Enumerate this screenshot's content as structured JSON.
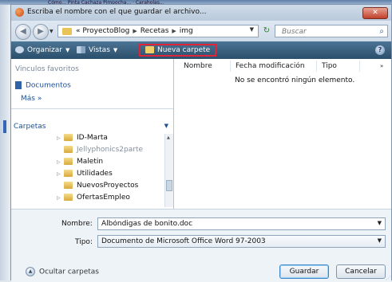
{
  "background": {
    "tabs_text": "Cómo... Pinta Cachaza Pimpocha... · Caraholas..."
  },
  "dialog": {
    "title": "Escriba el nombre con el que guardar el archivo...",
    "close_label": "✕",
    "address": {
      "crumbs": [
        "« ProyectoBlog",
        "Recetas",
        "img"
      ],
      "search_placeholder": "Buscar"
    },
    "toolbar": {
      "organizar": "Organizar",
      "vistas": "Vistas",
      "nueva_carpeta": "Nueva carpete",
      "highlight_color": "#e0243a"
    },
    "left_pane": {
      "favoritos_heading": "Vinculos favoritos",
      "documentos": "Documentos",
      "mas": "Más »",
      "carpetas": "Carpetas",
      "tree": [
        {
          "label": "ID-Marta",
          "expandable": true
        },
        {
          "label": "Jellyphonics2parte",
          "expandable": false
        },
        {
          "label": "Maletin",
          "expandable": true
        },
        {
          "label": "Utilidades",
          "expandable": true
        },
        {
          "label": "NuevosProyectos",
          "expandable": false
        },
        {
          "label": "OfertasEmpleo",
          "expandable": true
        }
      ]
    },
    "right_pane": {
      "columns": [
        "Nombre",
        "Fecha modificación",
        "Tipo"
      ],
      "more_columns": "»",
      "empty_message": "No se encontró ningún elemento."
    },
    "form": {
      "nombre_label": "Nombre:",
      "nombre_value": "Albóndigas de bonito.doc",
      "tipo_label": "Tipo:",
      "tipo_value": "Documento de Microsoft Office Word 97-2003"
    },
    "footer": {
      "ocultar_carpetas": "Ocultar carpetas",
      "guardar": "Guardar",
      "cancelar": "Cancelar"
    }
  }
}
